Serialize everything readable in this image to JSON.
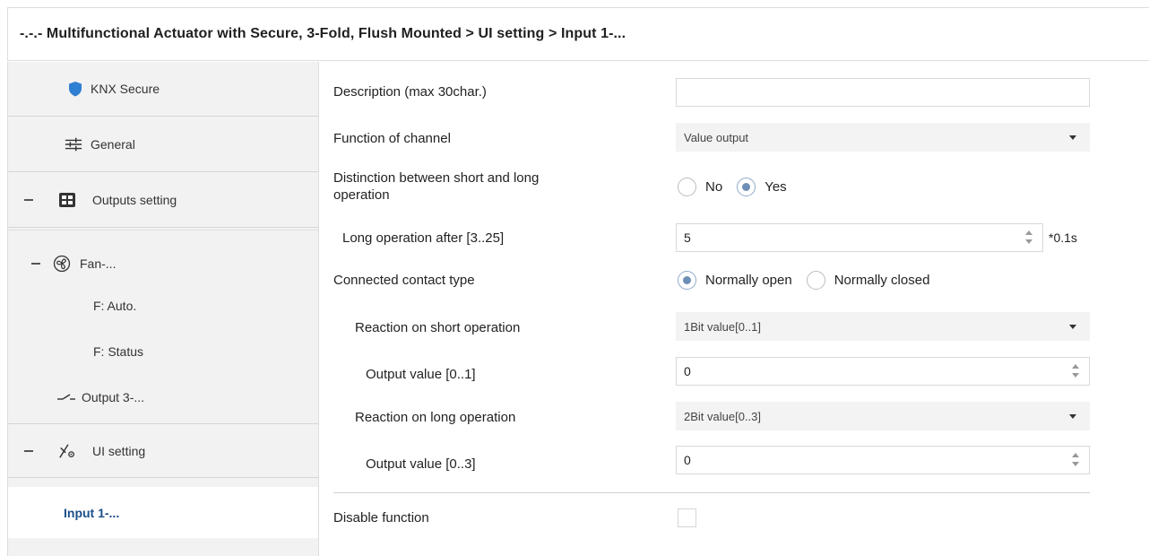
{
  "window": {
    "title": "-.-.- Multifunctional Actuator with Secure, 3-Fold, Flush Mounted > UI setting > Input 1-..."
  },
  "sidebar": {
    "items": [
      {
        "label": "KNX Secure",
        "icon": "shield-icon"
      },
      {
        "label": "General",
        "icon": "sliders-icon"
      },
      {
        "label": "Outputs setting",
        "icon": "grid-icon",
        "expanded": true
      },
      {
        "label": "Fan-...",
        "icon": "fan-icon",
        "expanded": true
      },
      {
        "label": "F: Auto."
      },
      {
        "label": "F: Status"
      },
      {
        "label": "Output 3-...",
        "icon": "switch-icon"
      },
      {
        "label": "UI setting",
        "icon": "ui-icon",
        "expanded": true
      },
      {
        "label": "Input 1-...",
        "selected": true
      }
    ]
  },
  "form": {
    "description": {
      "label": "Description (max 30char.)",
      "value": ""
    },
    "function_of_channel": {
      "label": "Function of channel",
      "value": "Value output"
    },
    "distinction": {
      "label_line1": "Distinction between short and long",
      "label_line2": "operation",
      "options": [
        "No",
        "Yes"
      ],
      "selected": "Yes"
    },
    "long_operation_after": {
      "label": "Long operation after [3..25]",
      "value": "5",
      "unit": "*0.1s"
    },
    "contact_type": {
      "label": "Connected contact type",
      "options": [
        "Normally open",
        "Normally closed"
      ],
      "selected": "Normally open"
    },
    "reaction_short": {
      "label": "Reaction on short operation",
      "value": "1Bit value[0..1]"
    },
    "output_value_short": {
      "label": "Output value [0..1]",
      "value": "0"
    },
    "reaction_long": {
      "label": "Reaction on long operation",
      "value": "2Bit value[0..3]"
    },
    "output_value_long": {
      "label": "Output value [0..3]",
      "value": "0"
    },
    "disable_function": {
      "label": "Disable function",
      "checked": false
    }
  },
  "colors": {
    "accent": "#1a4f8a",
    "radio_selected": "#6d8fb5",
    "sidebar_bg": "#f2f2f2",
    "shield": "#2f7fd3"
  }
}
